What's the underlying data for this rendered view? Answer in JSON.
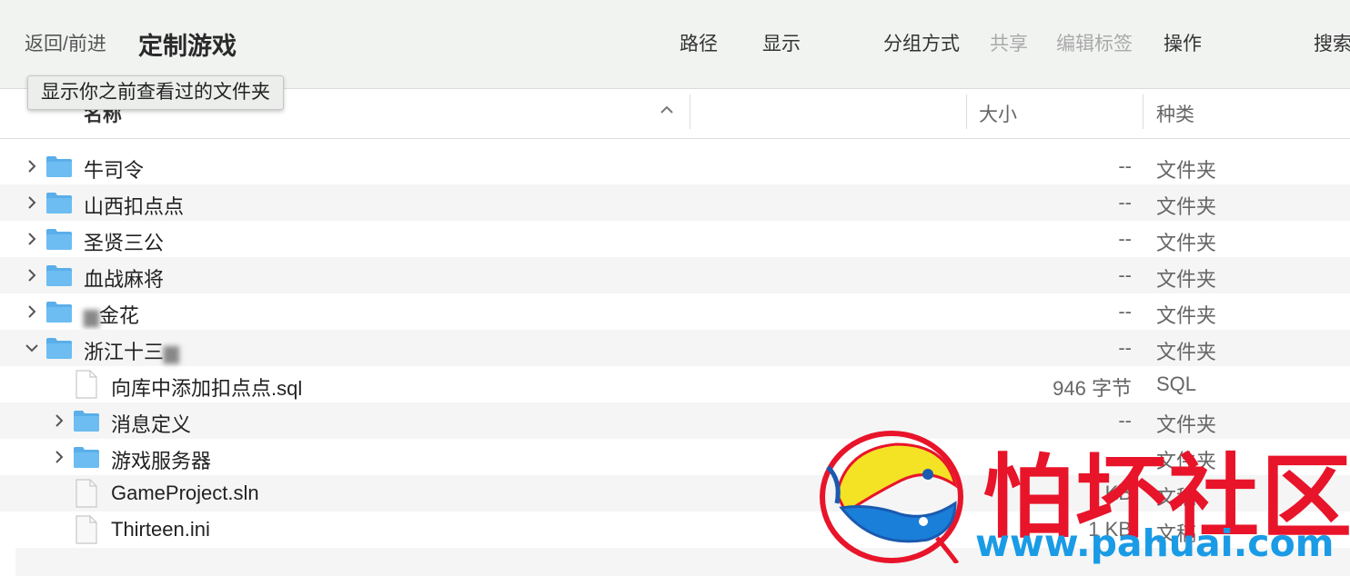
{
  "toolbar": {
    "nav": "返回/前进",
    "title": "定制游戏",
    "path": "路径",
    "view": "显示",
    "group": "分组方式",
    "share": "共享",
    "tags": "编辑标签",
    "action": "操作",
    "search": "搜索"
  },
  "tooltip": "显示你之前查看过的文件夹",
  "columns": {
    "name": "名称",
    "size": "大小",
    "kind": "种类"
  },
  "rows": [
    {
      "name": "牛司令",
      "size": "--",
      "kind": "文件夹"
    },
    {
      "name": "山西扣点点",
      "size": "--",
      "kind": "文件夹"
    },
    {
      "name": "圣贤三公",
      "size": "--",
      "kind": "文件夹"
    },
    {
      "name": "血战麻将",
      "size": "--",
      "kind": "文件夹"
    },
    {
      "name": "金花",
      "size": "--",
      "kind": "文件夹"
    },
    {
      "name": "浙江十三",
      "size": "--",
      "kind": "文件夹"
    },
    {
      "name": "向库中添加扣点点.sql",
      "size": "946 字节",
      "kind": "SQL"
    },
    {
      "name": "消息定义",
      "size": "--",
      "kind": "文件夹"
    },
    {
      "name": "游戏服务器",
      "size": "",
      "kind": "文件夹"
    },
    {
      "name": "GameProject.sln",
      "size": "1 KB",
      "kind": "文稿"
    },
    {
      "name": "Thirteen.ini",
      "size": "1 KB",
      "kind": "文稿"
    }
  ],
  "watermark": {
    "title": "怕坏社区",
    "url": "www.pahuai.com"
  },
  "colors": {
    "folder": "#5aaeea",
    "watermark_red": "#e8142a",
    "watermark_blue": "#1a9be6"
  }
}
